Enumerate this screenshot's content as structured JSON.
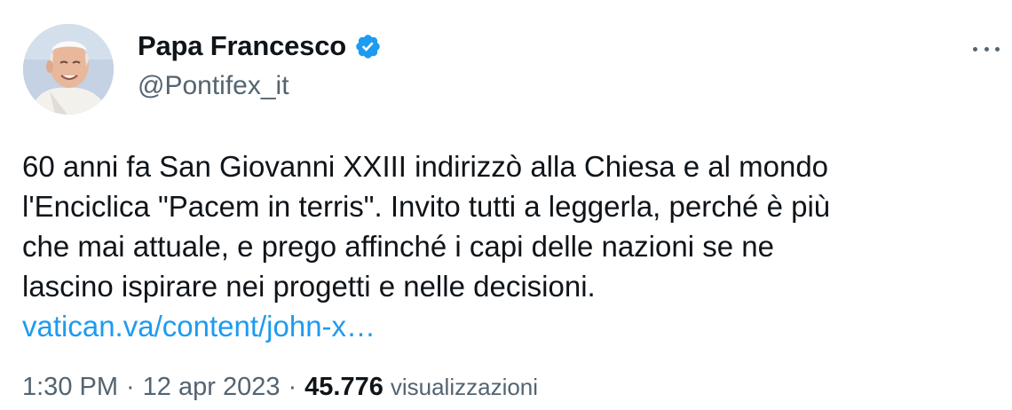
{
  "author": {
    "display_name": "Papa Francesco",
    "handle": "@Pontifex_it",
    "verified": true,
    "avatar_icon": "pope-portrait-avatar"
  },
  "tweet": {
    "text": "60 anni fa San Giovanni XXIII indirizzò alla Chiesa e al mondo\nl'Enciclica \"Pacem in terris\". Invito tutti a leggerla, perché è più\nche mai attuale, e prego affinché i capi delle nazioni se ne\nlascino ispirare nei progetti e nelle decisioni.",
    "link": "vatican.va/content/john-x…"
  },
  "meta": {
    "time": "1:30 PM",
    "separator": "·",
    "date": "12 apr 2023",
    "views_count": "45.776",
    "views_label": "visualizzazioni"
  },
  "colors": {
    "text": "#0f1419",
    "secondary": "#536471",
    "link": "#1d9bf0",
    "verified_badge": "#1d9bf0"
  },
  "icons": {
    "verified": "verified-badge-icon",
    "more": "more-options-icon"
  }
}
